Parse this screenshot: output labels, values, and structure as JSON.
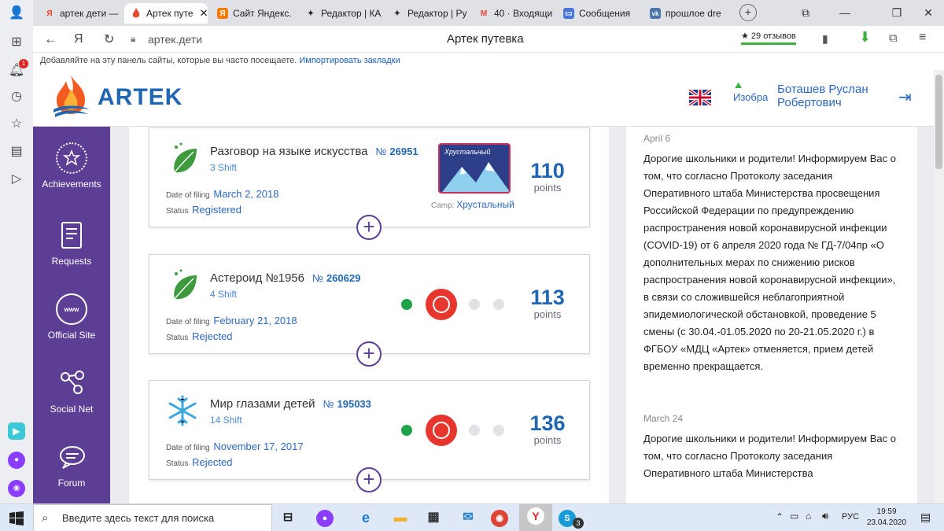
{
  "browser": {
    "tabs": [
      {
        "label": "артек дети —",
        "fav": "Я",
        "fav_color": "#fc3f1d"
      },
      {
        "label": "Артек путе",
        "fav": "",
        "fav_color": "#e8492c"
      },
      {
        "label": "Сайт Яндекс.",
        "fav": "Я",
        "fav_color": "#f57c00"
      },
      {
        "label": "Редактор | КА",
        "fav": "✦",
        "fav_color": "#222"
      },
      {
        "label": "Редактор | Ру",
        "fav": "✦",
        "fav_color": "#222"
      },
      {
        "label": "40 · Входящи",
        "fav": "M",
        "fav_color": "#ea4335"
      },
      {
        "label": "Сообщения",
        "fav": "▣",
        "fav_color": "#4a76d9"
      },
      {
        "label": "прошлое dre",
        "fav": "vk",
        "fav_color": "#4a76a8"
      }
    ],
    "address": "артек.дети",
    "page_title": "Артек путевка",
    "reviews": "29 отзывов",
    "bookmarks_hint": "Добавляйте на эту панель сайты, которые вы часто посещаете.",
    "bookmarks_link": "Импортировать закладки",
    "notif_count": "1"
  },
  "site": {
    "logo": "ARTEK",
    "user_name_1": "Боташев Руслан",
    "user_name_2": "Робертович",
    "avatar_alt": "Изобра"
  },
  "nav": [
    {
      "label": "Achievements"
    },
    {
      "label": "Requests"
    },
    {
      "label": "Official Site",
      "badge": "www"
    },
    {
      "label": "Social Net"
    },
    {
      "label": "Forum"
    }
  ],
  "cards": [
    {
      "title": "Разговор на языке искусства",
      "no_label": "№",
      "no": "26951",
      "shift": "3 Shift",
      "date_label": "Date of filing",
      "date": "March 2, 2018",
      "status_label": "Status",
      "status": "Registered",
      "points": "110",
      "points_label": "points",
      "camp_label": "Camp:",
      "camp": "Хрустальный",
      "camp_logo": "Хрустальный"
    },
    {
      "title": "Астероид №1956",
      "no_label": "№",
      "no": "260629",
      "shift": "4 Shift",
      "date_label": "Date of filing",
      "date": "February 21, 2018",
      "status_label": "Status",
      "status": "Rejected",
      "points": "113",
      "points_label": "points"
    },
    {
      "title": "Мир глазами детей",
      "no_label": "№",
      "no": "195033",
      "shift": "14 Shift",
      "date_label": "Date of filing",
      "date": "November 17, 2017",
      "status_label": "Status",
      "status": "Rejected",
      "points": "136",
      "points_label": "points"
    }
  ],
  "news": [
    {
      "date": "April 6",
      "text": "Дорогие школьники и родители! Информируем Вас о том, что согласно Протоколу заседания Оперативного штаба Министерства просвещения Российской Федерации по предупреждению распространения новой коронавирусной инфекции (COVID-19) от 6 апреля 2020 года № ГД-7/04пр «О дополнительных мерах по снижению рисков распространения новой коронавирусной инфекции», в связи со сложившейся неблагоприятной эпидемиологической обстановкой, проведение 5 смены (с 30.04.-01.05.2020 по 20-21.05.2020 г.) в ФГБОУ «МДЦ «Артек» отменяется, прием детей временно прекращается."
    },
    {
      "date": "March 24",
      "text": "Дорогие школьники и родители! Информируем Вас о том, что согласно Протоколу заседания Оперативного штаба Министерства"
    }
  ],
  "taskbar": {
    "search_placeholder": "Введите здесь текст для поиска",
    "lang": "РУС",
    "time": "19:59",
    "date": "23.04.2020",
    "skype_count": "3"
  }
}
